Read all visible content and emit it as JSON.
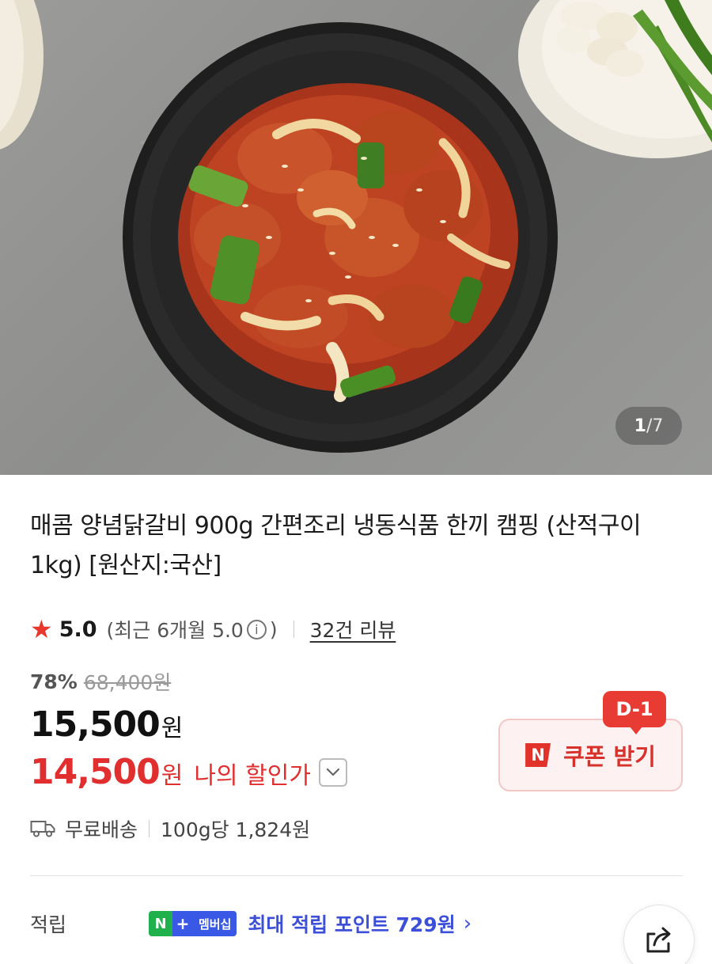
{
  "gallery": {
    "current": "1",
    "separator": "/",
    "total": "7"
  },
  "product": {
    "title": "매콤 양념닭갈비 900g 간편조리 냉동식품 한끼 캠핑 (산적구이 1kg) [원산지:국산]"
  },
  "rating": {
    "score": "5.0",
    "recent_prefix": "(최근 6개월 5.0",
    "recent_suffix": ")",
    "info_icon": "i",
    "reviews": "32건 리뷰"
  },
  "price": {
    "discount_rate": "78%",
    "original": "68,400원",
    "sale_amount": "15,500",
    "sale_unit": "원",
    "my_amount": "14,500",
    "my_unit": "원",
    "my_label": "나의 할인가"
  },
  "coupon": {
    "badge": "D-1",
    "icon_letter": "N",
    "label": "쿠폰 받기"
  },
  "shipping": {
    "free": "무료배송",
    "per_unit": "100g당 1,824원"
  },
  "points": {
    "label": "적립",
    "badge_n": "N",
    "badge_plus": "+",
    "badge_member": "멤버십",
    "text": "최대 적립 포인트 729원",
    "chevron": "›"
  },
  "colors": {
    "accent_red": "#e12e2e",
    "points_blue": "#3c4fd9",
    "npay_green": "#21b14c"
  },
  "icons": {
    "rating": "star-icon",
    "info": "info-icon",
    "shipping": "truck-icon",
    "share": "share-icon",
    "coupon": "naver-n-icon"
  }
}
